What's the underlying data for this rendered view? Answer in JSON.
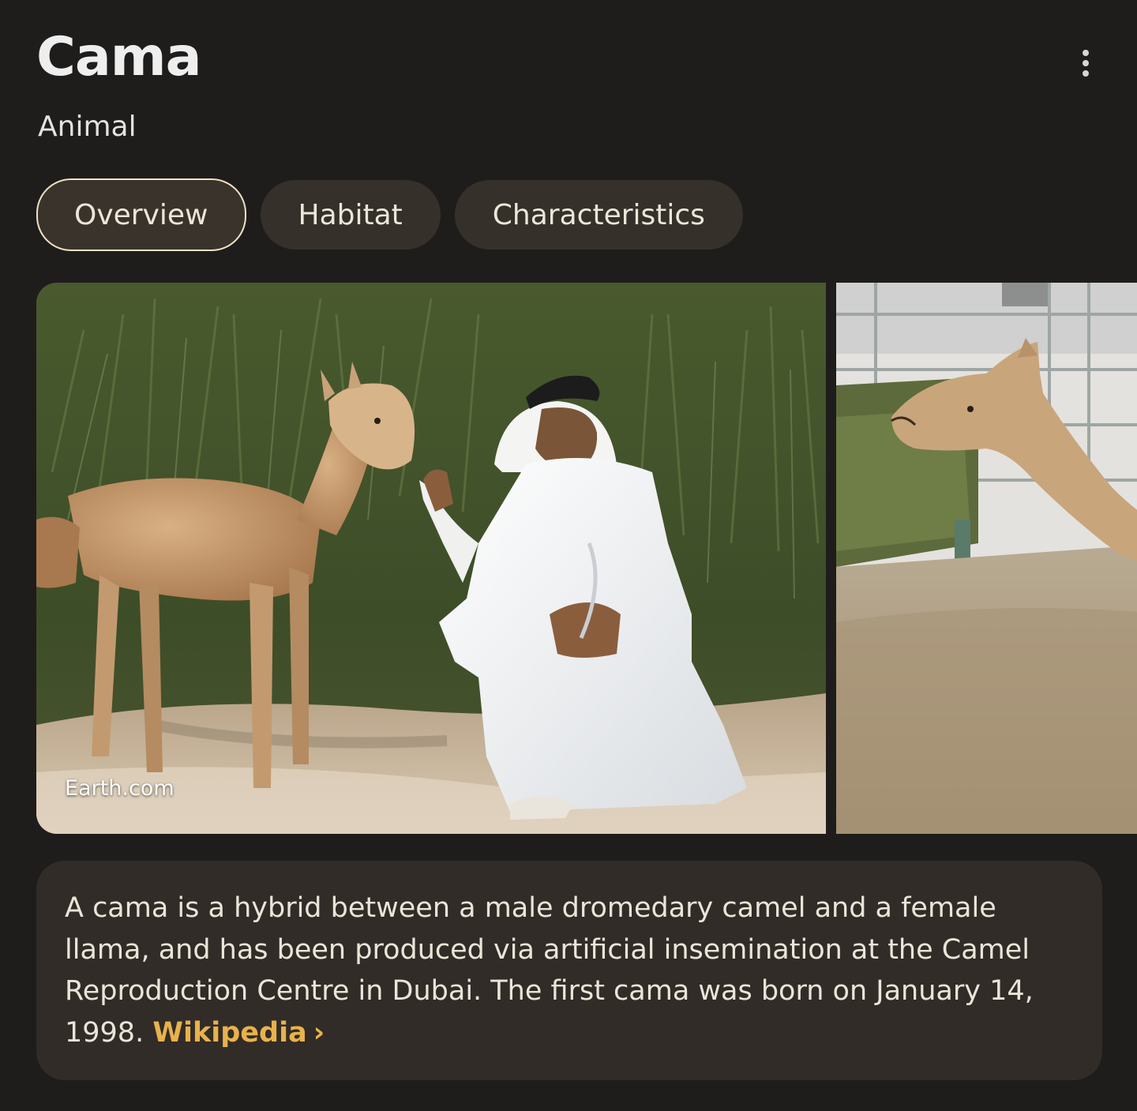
{
  "header": {
    "title": "Cama",
    "subtitle": "Animal"
  },
  "menu": {
    "icon": "more-vert-icon"
  },
  "tabs": [
    {
      "label": "Overview",
      "active": true
    },
    {
      "label": "Habitat",
      "active": false
    },
    {
      "label": "Characteristics",
      "active": false
    }
  ],
  "gallery": {
    "images": [
      {
        "subject": "man in white robe crouching beside baby cama",
        "source": "Earth.com"
      },
      {
        "subject": "light brown cama near fence"
      }
    ]
  },
  "description": {
    "text": "A cama is a hybrid between a male dromedary camel and a female llama, and has been produced via artificial insemination at the Camel Reproduction Centre in Dubai. The first cama was born on January 14, 1998.",
    "link_label": "Wikipedia",
    "link_icon": "chevron-right-icon",
    "link_chevron": "›"
  },
  "colors": {
    "background": "#1e1d1c",
    "tab_background": "#35302a",
    "tab_active_border": "#efe2c6",
    "card_background": "#312c27",
    "link": "#e8b24c"
  }
}
